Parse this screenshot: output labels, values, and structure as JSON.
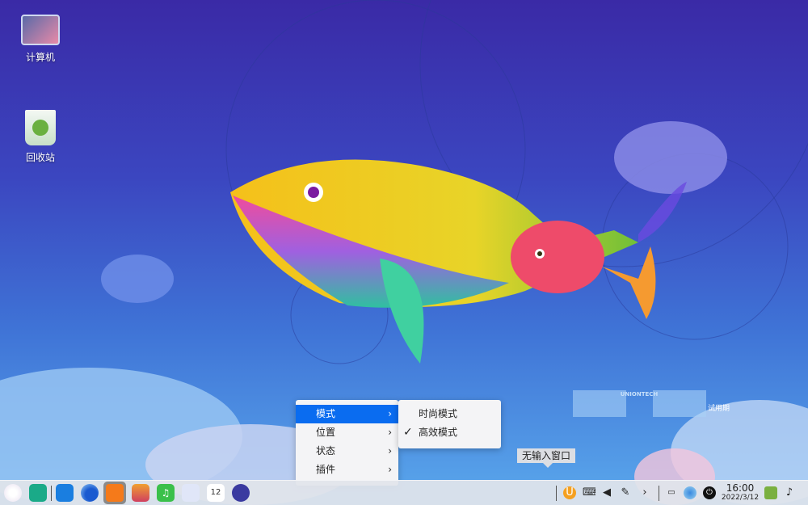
{
  "desktop": {
    "icons": [
      {
        "label": "计算机",
        "icon": "computer-icon"
      },
      {
        "label": "回收站",
        "icon": "trash-icon"
      }
    ],
    "watermark": {
      "brand": "UNIONTECH",
      "trial": "试用期"
    }
  },
  "context_menu": {
    "items": [
      {
        "label": "模式",
        "active": true
      },
      {
        "label": "位置"
      },
      {
        "label": "状态"
      },
      {
        "label": "插件"
      }
    ],
    "arrow": "›"
  },
  "submenu": {
    "items": [
      {
        "label": "时尚模式",
        "checked": false
      },
      {
        "label": "高效模式",
        "checked": true
      }
    ],
    "check": "✓"
  },
  "tooltip": "无输入窗口",
  "taskbar": {
    "apps": [
      "launcher-icon",
      "file-manager-icon",
      "app-store-icon",
      "browser-icon",
      "deepin-store-icon",
      "image-viewer-icon",
      "music-icon",
      "document-viewer-icon",
      "calendar-icon",
      "settings-icon"
    ],
    "calendar_day": "12",
    "clock": {
      "time": "16:00",
      "date": "2022/3/12"
    }
  },
  "colors": {
    "accent": "#0a6cf0"
  }
}
